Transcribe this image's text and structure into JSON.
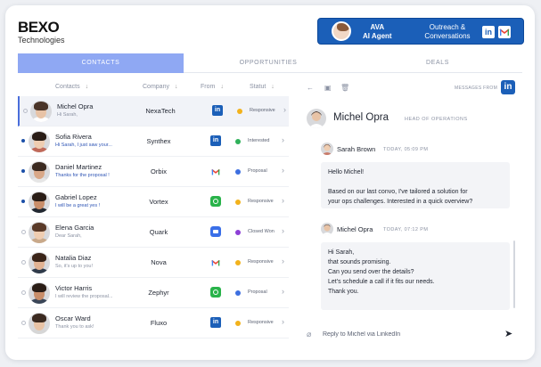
{
  "brand": {
    "name": "BEXO",
    "subtitle": "Technologies"
  },
  "agent": {
    "name_line1": "AVA",
    "name_line2": "AI Agent",
    "campaign_line1": "Outreach &",
    "campaign_line2": "Conversations"
  },
  "tabs": [
    {
      "label": "CONTACTS",
      "active": true
    },
    {
      "label": "OPPORTUNITIES",
      "active": false
    },
    {
      "label": "DEALS",
      "active": false
    }
  ],
  "table": {
    "headers": {
      "contacts": "Contacts",
      "company": "Company",
      "from": "From",
      "status": "Statut"
    },
    "sort_icon": "arrow-down-icon",
    "rows": [
      {
        "name": "Michel Opra",
        "preview": "Hi Sarah,",
        "company": "NexaTech",
        "source": "linkedin",
        "status": "Responsive",
        "status_color": "#f2b21c",
        "unread": false,
        "selected": true
      },
      {
        "name": "Sofia Rivera",
        "preview": "Hi Sarah, I just saw your...",
        "company": "Synthex",
        "source": "linkedin",
        "status": "Interested",
        "status_color": "#2fb15a",
        "unread": true,
        "selected": false
      },
      {
        "name": "Daniel Martinez",
        "preview": "Thanks for the proposal !",
        "company": "Orbix",
        "source": "gmail",
        "status": "Proposal",
        "status_color": "#3d6fe0",
        "unread": true,
        "selected": false
      },
      {
        "name": "Gabriel Lopez",
        "preview": "I will be a great yes !",
        "company": "Vortex",
        "source": "whatsapp",
        "status": "Responsive",
        "status_color": "#f2b21c",
        "unread": true,
        "selected": false
      },
      {
        "name": "Elena Garcia",
        "preview": "Dear Sarah,",
        "company": "Quark",
        "source": "meet",
        "status": "Closed Won",
        "status_color": "#8d3fd6",
        "unread": false,
        "selected": false
      },
      {
        "name": "Natalia Diaz",
        "preview": "So, it's up to you!",
        "company": "Nova",
        "source": "gmail",
        "status": "Responsive",
        "status_color": "#f2b21c",
        "unread": false,
        "selected": false
      },
      {
        "name": "Victor Harris",
        "preview": "I will review the proposal...",
        "company": "Zephyr",
        "source": "whatsapp",
        "status": "Proposal",
        "status_color": "#3d6fe0",
        "unread": false,
        "selected": false
      },
      {
        "name": "Oscar Ward",
        "preview": "Thank you to ask!",
        "company": "Fluxo",
        "source": "linkedin",
        "status": "Responsive",
        "status_color": "#f2b21c",
        "unread": false,
        "selected": false
      }
    ]
  },
  "conversation": {
    "messages_from_label": "MESSAGES FROM",
    "contact_name": "Michel Opra",
    "contact_role": "HEAD OF OPERATIONS",
    "messages": [
      {
        "author": "Sarah Brown",
        "time": "TODAY, 05:09 PM",
        "lines": [
          "Hello Michel!",
          "",
          "Based on our last convo, I've tailored a solution for",
          "your ops challenges. Interested in a quick overview?"
        ]
      },
      {
        "author": "Michel Opra",
        "time": "TODAY, 07:12 PM",
        "lines": [
          "Hi Sarah,",
          "that sounds promising.",
          "Can you send over the details?",
          "Let's schedule a call if it fits our needs.",
          "Thank you."
        ]
      }
    ],
    "reply_placeholder": "Reply to Michel via LinkedIn"
  },
  "colors": {
    "accent": "#1b5fb8",
    "tab_active": "#8fa8f3",
    "linkedin": "#1b5fb8"
  }
}
